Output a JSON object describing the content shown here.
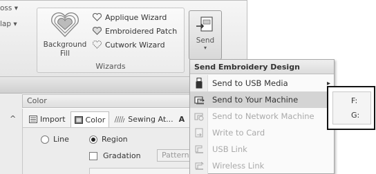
{
  "ribbon": {
    "partial_item_1": "oss",
    "partial_item_2": "lap",
    "background_fill": {
      "line1": "Background",
      "line2": "Fill"
    },
    "wizards": [
      {
        "label": "Applique Wizard",
        "icon": "heart-outline-icon"
      },
      {
        "label": "Embroidered Patch",
        "icon": "heart-patch-icon"
      },
      {
        "label": "Cutwork Wizard",
        "icon": "cutwork-heart-icon"
      }
    ],
    "wizards_group_label": "Wizards",
    "send_label": "Send",
    "send_arrow": "▾",
    "dropdown_arrow": "▾"
  },
  "panel": {
    "header": "Color",
    "collapse_glyph": "^",
    "tabs": [
      {
        "label": "Import",
        "icon": "import-icon"
      },
      {
        "label": "Color",
        "icon": "color-icon"
      },
      {
        "label": "Sewing At...",
        "icon": "sewing-attributes-icon"
      }
    ],
    "tab_overflow": "A",
    "line_option": "Line",
    "region_option": "Region",
    "gradation_label": "Gradation",
    "pattern_button": "Pattern..."
  },
  "menu": {
    "title": "Send Embroidery Design",
    "items": [
      {
        "label": "Send to USB Media",
        "icon": "usb-icon",
        "disabled": false,
        "submenu": true
      },
      {
        "label": "Send to Your Machine",
        "icon": "machine-icon",
        "disabled": false,
        "highlighted": true
      },
      {
        "label": "Send to Network Machine",
        "icon": "network-machine-icon",
        "disabled": true
      },
      {
        "label": "Write to Card",
        "icon": "card-icon",
        "disabled": true
      },
      {
        "label": "USB Link",
        "icon": "usb-link-icon",
        "disabled": true
      },
      {
        "label": "Wireless Link",
        "icon": "wireless-link-icon",
        "disabled": true
      }
    ],
    "submenu_arrow": "▸"
  },
  "submenu": {
    "items": [
      "F:",
      "G:"
    ]
  }
}
